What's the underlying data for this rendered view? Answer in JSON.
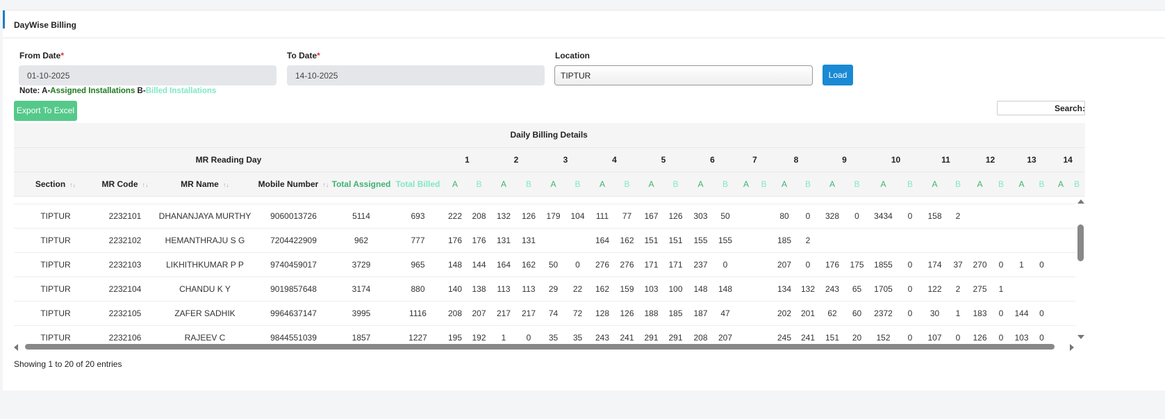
{
  "panel": {
    "title": "DayWise Billing"
  },
  "filters": {
    "from_label": "From Date",
    "to_label": "To Date",
    "required_mark": "*",
    "location_label": "Location",
    "from_value": "01-10-2025",
    "to_value": "14-10-2025",
    "location_value": "TIPTUR",
    "load_label": "Load"
  },
  "note": {
    "prefix": "Note: A-",
    "assigned": "Assigned Installations",
    "mid": " B-",
    "billed": "Billed Installations"
  },
  "export_label": "Export To Excel",
  "search_label": "Search:",
  "table": {
    "group_title": "Daily Billing Details",
    "reading_day_label": "MR Reading Day",
    "days": [
      "1",
      "2",
      "3",
      "4",
      "5",
      "6",
      "7",
      "8",
      "9",
      "10",
      "11",
      "12",
      "13",
      "14"
    ],
    "columns": [
      "Section",
      "MR Code",
      "MR Name",
      "Mobile Number",
      "Total Assigned",
      "Total Billed"
    ],
    "a_label": "A",
    "b_label": "B",
    "rows": [
      {
        "section": "TIPTUR",
        "code": "2232101",
        "name": "DHANANJAYA MURTHY",
        "mobile": "9060013726",
        "assigned": "5114",
        "billed": "693",
        "days": [
          [
            "222",
            "208"
          ],
          [
            "132",
            "126"
          ],
          [
            "179",
            "104"
          ],
          [
            "111",
            "77"
          ],
          [
            "167",
            "126"
          ],
          [
            "303",
            "50"
          ],
          [
            "",
            ""
          ],
          [
            "80",
            "0"
          ],
          [
            "328",
            "0"
          ],
          [
            "3434",
            "0"
          ],
          [
            "158",
            "2"
          ],
          [
            "",
            ""
          ],
          [
            "",
            ""
          ],
          [
            "",
            ""
          ]
        ]
      },
      {
        "section": "TIPTUR",
        "code": "2232102",
        "name": "HEMANTHRAJU S G",
        "mobile": "7204422909",
        "assigned": "962",
        "billed": "777",
        "days": [
          [
            "176",
            "176"
          ],
          [
            "131",
            "131"
          ],
          [
            "",
            ""
          ],
          [
            "164",
            "162"
          ],
          [
            "151",
            "151"
          ],
          [
            "155",
            "155"
          ],
          [
            "",
            ""
          ],
          [
            "185",
            "2"
          ],
          [
            "",
            ""
          ],
          [
            "",
            ""
          ],
          [
            "",
            ""
          ],
          [
            "",
            ""
          ],
          [
            "",
            ""
          ],
          [
            "",
            ""
          ]
        ]
      },
      {
        "section": "TIPTUR",
        "code": "2232103",
        "name": "LIKHITHKUMAR P P",
        "mobile": "9740459017",
        "assigned": "3729",
        "billed": "965",
        "days": [
          [
            "148",
            "144"
          ],
          [
            "164",
            "162"
          ],
          [
            "50",
            "0"
          ],
          [
            "276",
            "276"
          ],
          [
            "171",
            "171"
          ],
          [
            "237",
            "0"
          ],
          [
            "",
            ""
          ],
          [
            "207",
            "0"
          ],
          [
            "176",
            "175"
          ],
          [
            "1855",
            "0"
          ],
          [
            "174",
            "37"
          ],
          [
            "270",
            "0"
          ],
          [
            "1",
            "0"
          ],
          [
            "",
            ""
          ]
        ]
      },
      {
        "section": "TIPTUR",
        "code": "2232104",
        "name": "CHANDU K Y",
        "mobile": "9019857648",
        "assigned": "3174",
        "billed": "880",
        "days": [
          [
            "140",
            "138"
          ],
          [
            "113",
            "113"
          ],
          [
            "29",
            "22"
          ],
          [
            "162",
            "159"
          ],
          [
            "103",
            "100"
          ],
          [
            "148",
            "148"
          ],
          [
            "",
            ""
          ],
          [
            "134",
            "132"
          ],
          [
            "243",
            "65"
          ],
          [
            "1705",
            "0"
          ],
          [
            "122",
            "2"
          ],
          [
            "275",
            "1"
          ],
          [
            "",
            ""
          ],
          [
            "",
            ""
          ]
        ]
      },
      {
        "section": "TIPTUR",
        "code": "2232105",
        "name": "ZAFER SADHIK",
        "mobile": "9964637147",
        "assigned": "3995",
        "billed": "1116",
        "days": [
          [
            "208",
            "207"
          ],
          [
            "217",
            "217"
          ],
          [
            "74",
            "72"
          ],
          [
            "128",
            "126"
          ],
          [
            "188",
            "185"
          ],
          [
            "187",
            "47"
          ],
          [
            "",
            ""
          ],
          [
            "202",
            "201"
          ],
          [
            "62",
            "60"
          ],
          [
            "2372",
            "0"
          ],
          [
            "30",
            "1"
          ],
          [
            "183",
            "0"
          ],
          [
            "144",
            "0"
          ],
          [
            "",
            ""
          ]
        ]
      },
      {
        "section": "TIPTUR",
        "code": "2232106",
        "name": "RAJEEV C",
        "mobile": "9844551039",
        "assigned": "1857",
        "billed": "1227",
        "days": [
          [
            "195",
            "192"
          ],
          [
            "1",
            "0"
          ],
          [
            "35",
            "35"
          ],
          [
            "243",
            "241"
          ],
          [
            "291",
            "291"
          ],
          [
            "208",
            "207"
          ],
          [
            "",
            ""
          ],
          [
            "245",
            "241"
          ],
          [
            "151",
            "20"
          ],
          [
            "152",
            "0"
          ],
          [
            "107",
            "0"
          ],
          [
            "126",
            "0"
          ],
          [
            "103",
            "0"
          ],
          [
            "",
            ""
          ]
        ]
      }
    ]
  },
  "footer": {
    "info": "Showing 1 to 20 of 20 entries"
  }
}
